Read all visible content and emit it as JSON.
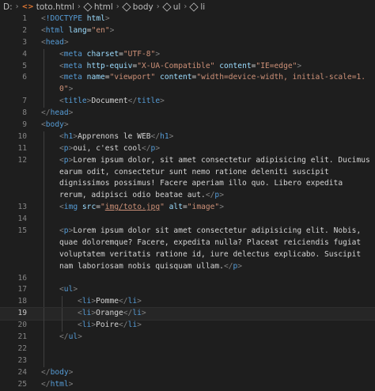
{
  "breadcrumb": {
    "drive": "D:",
    "file": "toto.html",
    "items": [
      "html",
      "body",
      "ul",
      "li"
    ]
  },
  "editor": {
    "current_line": 19,
    "lines": [
      {
        "n": "1",
        "i": 0,
        "t": [
          [
            "t",
            "<"
          ],
          [
            "n",
            "!DOCTYPE"
          ],
          [
            "x",
            " "
          ],
          [
            "a",
            "html"
          ],
          [
            "t",
            ">"
          ]
        ]
      },
      {
        "n": "2",
        "i": 0,
        "t": [
          [
            "t",
            "<"
          ],
          [
            "n",
            "html"
          ],
          [
            "x",
            " "
          ],
          [
            "a",
            "lang"
          ],
          [
            "x",
            "="
          ],
          [
            "s",
            "\"en\""
          ],
          [
            "t",
            ">"
          ]
        ]
      },
      {
        "n": "3",
        "i": 0,
        "t": [
          [
            "t",
            "<"
          ],
          [
            "n",
            "head"
          ],
          [
            "t",
            ">"
          ]
        ]
      },
      {
        "n": "4",
        "i": 1,
        "t": [
          [
            "t",
            "<"
          ],
          [
            "n",
            "meta"
          ],
          [
            "x",
            " "
          ],
          [
            "a",
            "charset"
          ],
          [
            "x",
            "="
          ],
          [
            "s",
            "\"UTF-8\""
          ],
          [
            "t",
            ">"
          ]
        ]
      },
      {
        "n": "5",
        "i": 1,
        "t": [
          [
            "t",
            "<"
          ],
          [
            "n",
            "meta"
          ],
          [
            "x",
            " "
          ],
          [
            "a",
            "http-equiv"
          ],
          [
            "x",
            "="
          ],
          [
            "s",
            "\"X-UA-Compatible\""
          ],
          [
            "x",
            " "
          ],
          [
            "a",
            "content"
          ],
          [
            "x",
            "="
          ],
          [
            "s",
            "\"IE=edge\""
          ],
          [
            "t",
            ">"
          ]
        ]
      },
      {
        "n": "6",
        "i": 1,
        "t": [
          [
            "t",
            "<"
          ],
          [
            "n",
            "meta"
          ],
          [
            "x",
            " "
          ],
          [
            "a",
            "name"
          ],
          [
            "x",
            "="
          ],
          [
            "s",
            "\"viewport\""
          ],
          [
            "x",
            " "
          ],
          [
            "a",
            "content"
          ],
          [
            "x",
            "="
          ],
          [
            "s",
            "\"width=device-width, initial-scale=1."
          ]
        ]
      },
      {
        "n": "",
        "i": 1,
        "t": [
          [
            "s",
            "0\""
          ],
          [
            "t",
            ">"
          ]
        ]
      },
      {
        "n": "7",
        "i": 1,
        "t": [
          [
            "t",
            "<"
          ],
          [
            "n",
            "title"
          ],
          [
            "t",
            ">"
          ],
          [
            "x",
            "Document"
          ],
          [
            "t",
            "</"
          ],
          [
            "n",
            "title"
          ],
          [
            "t",
            ">"
          ]
        ]
      },
      {
        "n": "8",
        "i": 0,
        "t": [
          [
            "t",
            "</"
          ],
          [
            "n",
            "head"
          ],
          [
            "t",
            ">"
          ]
        ]
      },
      {
        "n": "9",
        "i": 0,
        "t": [
          [
            "t",
            "<"
          ],
          [
            "n",
            "body"
          ],
          [
            "t",
            ">"
          ]
        ]
      },
      {
        "n": "10",
        "i": 1,
        "t": [
          [
            "t",
            "<"
          ],
          [
            "n",
            "h1"
          ],
          [
            "t",
            ">"
          ],
          [
            "x",
            "Apprenons le WEB"
          ],
          [
            "t",
            "</"
          ],
          [
            "n",
            "h1"
          ],
          [
            "t",
            ">"
          ]
        ]
      },
      {
        "n": "11",
        "i": 1,
        "t": [
          [
            "t",
            "<"
          ],
          [
            "n",
            "p"
          ],
          [
            "t",
            ">"
          ],
          [
            "x",
            "oui, c'est cool"
          ],
          [
            "t",
            "</"
          ],
          [
            "n",
            "p"
          ],
          [
            "t",
            ">"
          ]
        ]
      },
      {
        "n": "12",
        "i": 1,
        "t": [
          [
            "t",
            "<"
          ],
          [
            "n",
            "p"
          ],
          [
            "t",
            ">"
          ],
          [
            "x",
            "Lorem ipsum dolor, sit amet consectetur adipisicing elit. Ducimus"
          ]
        ]
      },
      {
        "n": "",
        "i": 1,
        "t": [
          [
            "x",
            "earum odit, consectetur sunt nemo ratione deleniti suscipit"
          ]
        ]
      },
      {
        "n": "",
        "i": 1,
        "t": [
          [
            "x",
            "dignissimos possimus! Facere aperiam illo quo. Libero expedita"
          ]
        ]
      },
      {
        "n": "",
        "i": 1,
        "t": [
          [
            "x",
            "rerum, adipisci odio beatae aut."
          ],
          [
            "t",
            "</"
          ],
          [
            "n",
            "p"
          ],
          [
            "t",
            ">"
          ]
        ]
      },
      {
        "n": "13",
        "i": 1,
        "t": [
          [
            "t",
            "<"
          ],
          [
            "n",
            "img"
          ],
          [
            "x",
            " "
          ],
          [
            "a",
            "src"
          ],
          [
            "x",
            "="
          ],
          [
            "s",
            "\""
          ],
          [
            "su",
            "img/toto.jpg"
          ],
          [
            "s",
            "\""
          ],
          [
            "x",
            " "
          ],
          [
            "a",
            "alt"
          ],
          [
            "x",
            "="
          ],
          [
            "s",
            "\"image\""
          ],
          [
            "t",
            ">"
          ]
        ]
      },
      {
        "n": "14",
        "i": 1,
        "t": []
      },
      {
        "n": "15",
        "i": 1,
        "t": [
          [
            "t",
            "<"
          ],
          [
            "n",
            "p"
          ],
          [
            "t",
            ">"
          ],
          [
            "x",
            "Lorem ipsum dolor sit amet consectetur adipisicing elit. Nobis,"
          ]
        ]
      },
      {
        "n": "",
        "i": 1,
        "t": [
          [
            "x",
            "quae doloremque? Facere, expedita nulla? Placeat reiciendis fugiat"
          ]
        ]
      },
      {
        "n": "",
        "i": 1,
        "t": [
          [
            "x",
            "voluptatem veritatis ratione id, iure delectus explicabo. Suscipit"
          ]
        ]
      },
      {
        "n": "",
        "i": 1,
        "t": [
          [
            "x",
            "nam laboriosam nobis quisquam ullam."
          ],
          [
            "t",
            "</"
          ],
          [
            "n",
            "p"
          ],
          [
            "t",
            ">"
          ]
        ]
      },
      {
        "n": "16",
        "i": 1,
        "t": []
      },
      {
        "n": "17",
        "i": 1,
        "t": [
          [
            "t",
            "<"
          ],
          [
            "n",
            "ul"
          ],
          [
            "t",
            ">"
          ]
        ]
      },
      {
        "n": "18",
        "i": 2,
        "t": [
          [
            "t",
            "<"
          ],
          [
            "n",
            "li"
          ],
          [
            "t",
            ">"
          ],
          [
            "x",
            "Pomme"
          ],
          [
            "t",
            "</"
          ],
          [
            "n",
            "li"
          ],
          [
            "t",
            ">"
          ]
        ]
      },
      {
        "n": "19",
        "i": 2,
        "t": [
          [
            "t",
            "<"
          ],
          [
            "n",
            "li"
          ],
          [
            "t",
            ">"
          ],
          [
            "x",
            "Orange"
          ],
          [
            "t",
            "</"
          ],
          [
            "n",
            "li"
          ],
          [
            "t",
            ">"
          ]
        ]
      },
      {
        "n": "20",
        "i": 2,
        "t": [
          [
            "t",
            "<"
          ],
          [
            "n",
            "li"
          ],
          [
            "t",
            ">"
          ],
          [
            "x",
            "Poire"
          ],
          [
            "t",
            "</"
          ],
          [
            "n",
            "li"
          ],
          [
            "t",
            ">"
          ]
        ]
      },
      {
        "n": "21",
        "i": 1,
        "t": [
          [
            "t",
            "</"
          ],
          [
            "n",
            "ul"
          ],
          [
            "t",
            ">"
          ]
        ]
      },
      {
        "n": "22",
        "i": 1,
        "t": []
      },
      {
        "n": "23",
        "i": 1,
        "t": []
      },
      {
        "n": "24",
        "i": 0,
        "t": [
          [
            "t",
            "</"
          ],
          [
            "n",
            "body"
          ],
          [
            "t",
            ">"
          ]
        ]
      },
      {
        "n": "25",
        "i": 0,
        "t": [
          [
            "t",
            "</"
          ],
          [
            "n",
            "html"
          ],
          [
            "t",
            ">"
          ]
        ]
      }
    ]
  }
}
